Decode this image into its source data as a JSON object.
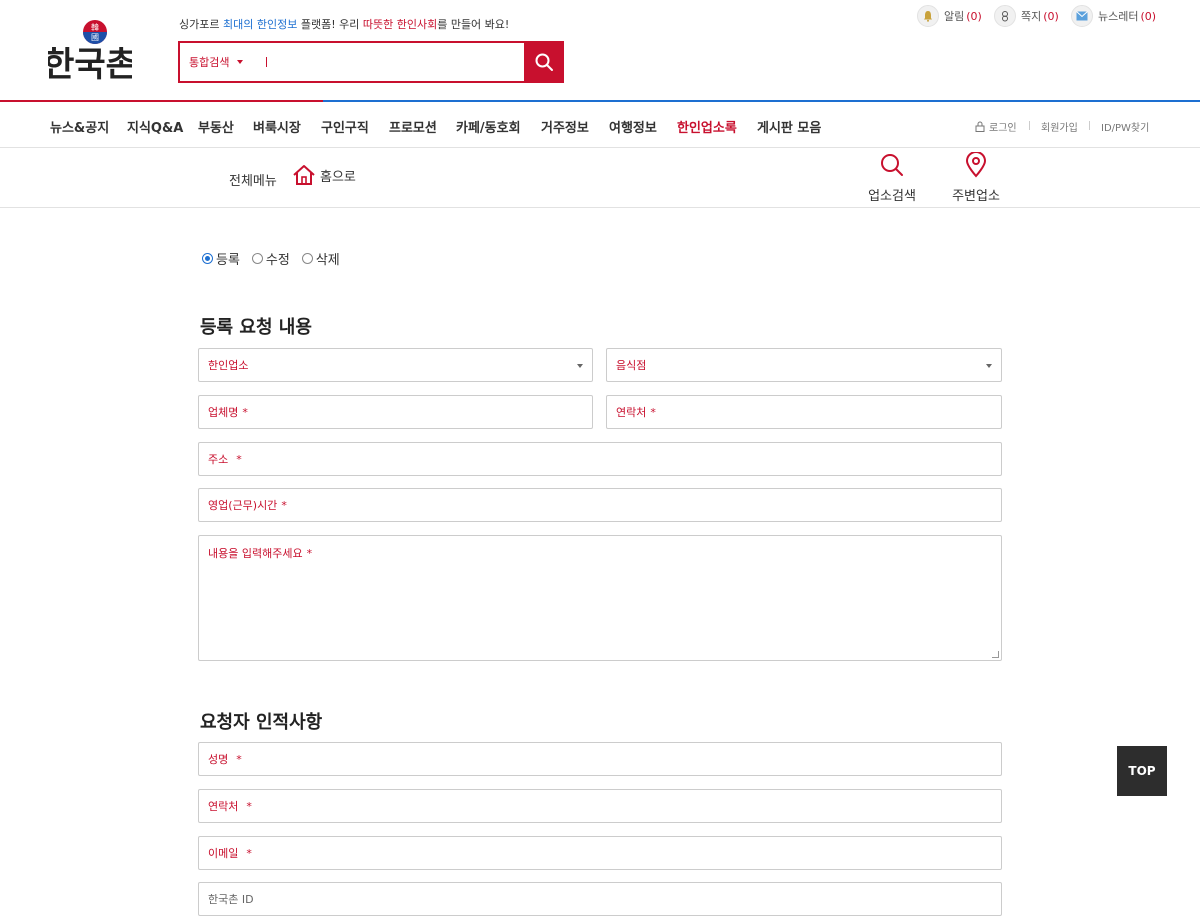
{
  "header": {
    "logo_text": "한국촌",
    "tagline": {
      "p1": "싱가포르 ",
      "p2": "최대의",
      "p3": " ",
      "p4": "한인정보",
      "p5": " 플랫폼! 우리 ",
      "p6": "따뜻한",
      "p7": " ",
      "p8": "한인사회",
      "p9": "를 만들어 봐요!"
    },
    "search": {
      "scope": "통합검색",
      "placeholder": ""
    },
    "util": [
      {
        "label": "알림",
        "count": "(0)",
        "icon": "bell-icon"
      },
      {
        "label": "쪽지",
        "count": "(0)",
        "icon": "note-icon"
      },
      {
        "label": "뉴스레터",
        "count": "(0)",
        "icon": "mail-icon"
      }
    ],
    "colors": {
      "accent": "#c8102e",
      "blue": "#1d6fd1"
    }
  },
  "gnb": {
    "items": [
      "뉴스&공지",
      "지식Q&A",
      "부동산",
      "벼룩시장",
      "구인구직",
      "프로모션",
      "카페/동호회",
      "거주정보",
      "여행정보",
      "한인업소록",
      "게시판 모음"
    ],
    "active": "한인업소록",
    "member": {
      "login": "로그인",
      "join": "회원가입",
      "find": "ID/PW찾기"
    }
  },
  "subbar": {
    "all_menu": "전체메뉴",
    "home": "홈으로",
    "tools": [
      {
        "label": "업소검색",
        "icon": "search-icon"
      },
      {
        "label": "주변업소",
        "icon": "map-pin-icon"
      }
    ]
  },
  "form": {
    "mode_options": [
      "등록",
      "수정",
      "삭제"
    ],
    "mode_selected": "등록",
    "section1_title": "등록 요청 내용",
    "category": "한인업소",
    "subcategory": "음식점",
    "business_name": "업체명",
    "business_phone": "연락처",
    "address": "주소",
    "hours": "영업(근무)시간",
    "content": "내용을 입력해주세요",
    "required_mark": "*",
    "section2_title": "요청자 인적사항",
    "requester_name": "성명",
    "requester_phone": "연락처",
    "requester_email": "이메일",
    "requester_id": "한국촌 ID"
  },
  "top_button": "TOP"
}
